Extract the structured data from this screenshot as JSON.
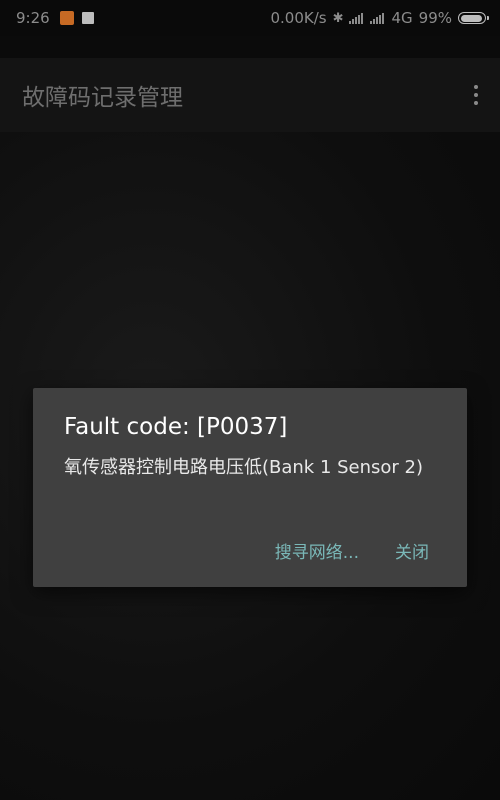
{
  "status_bar": {
    "time": "9:26",
    "network_speed": "0.00K/s",
    "network_type": "4G",
    "battery": "99%"
  },
  "app_bar": {
    "title": "故障码记录管理",
    "menu_icon": "overflow-menu-icon"
  },
  "dialog": {
    "title": "Fault code: [P0037]",
    "message": "氧传感器控制电路电压低(Bank 1 Sensor 2)",
    "buttons": {
      "search": "搜寻网络...",
      "close": "关闭"
    }
  },
  "colors": {
    "dialog_bg": "#404040",
    "accent": "#7ab8b8",
    "app_bar_bg": "#141414"
  }
}
